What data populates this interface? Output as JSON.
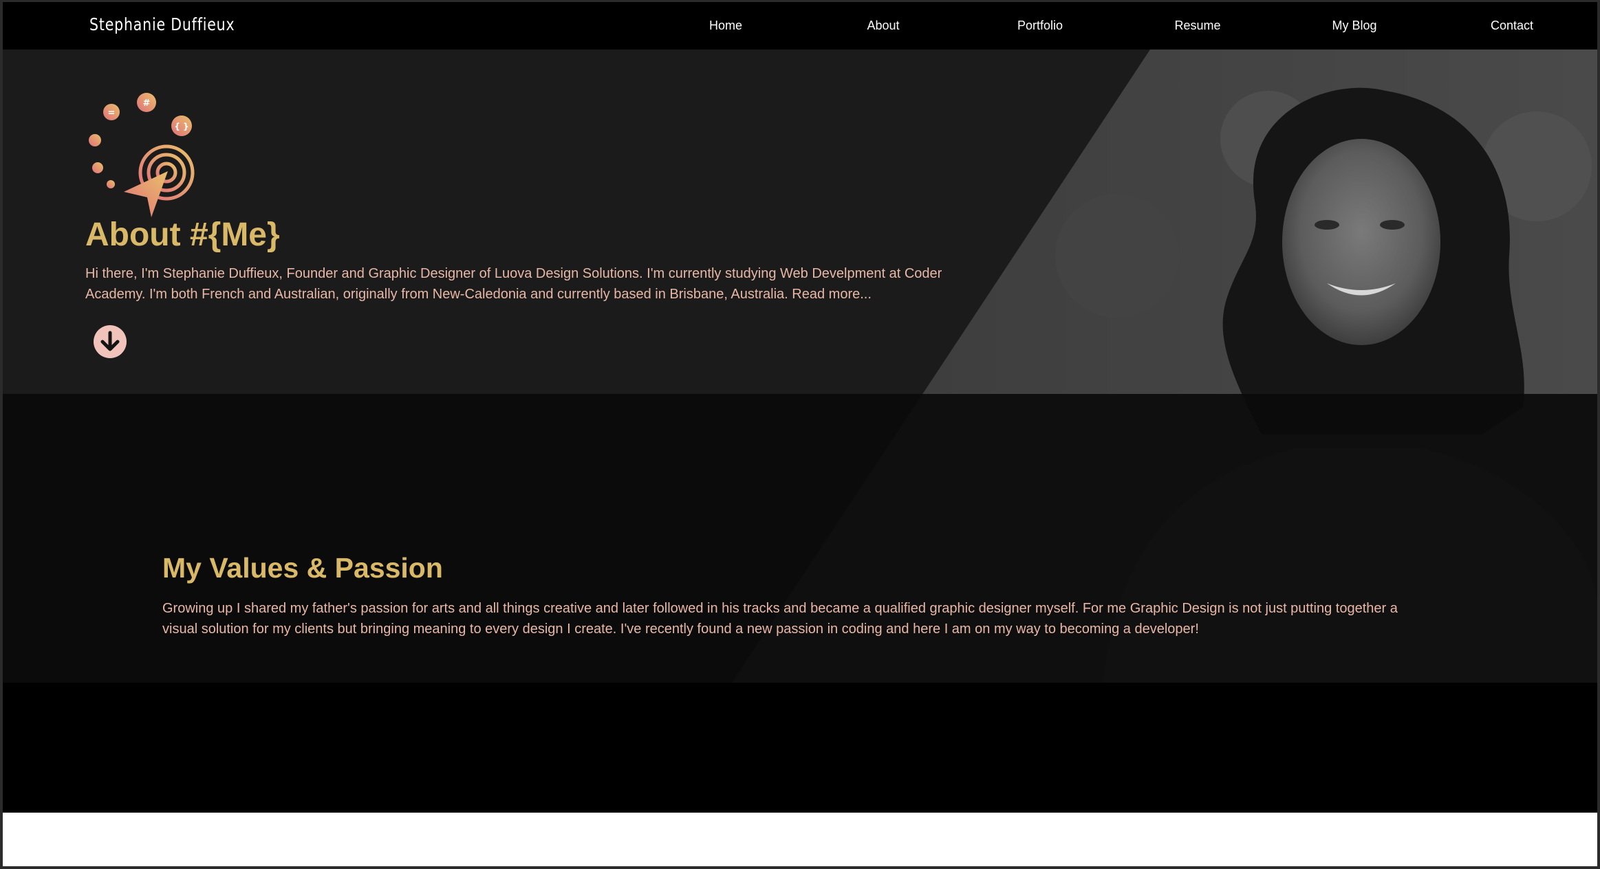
{
  "site": {
    "brand": "Stephanie Duffieux"
  },
  "nav": {
    "items": [
      {
        "label": "Home"
      },
      {
        "label": "About"
      },
      {
        "label": "Portfolio"
      },
      {
        "label": "Resume"
      },
      {
        "label": "My Blog"
      },
      {
        "label": "Contact"
      }
    ]
  },
  "about": {
    "title": "About #{Me}",
    "intro": "Hi there, I'm Stephanie Duffieux, Founder and Graphic Designer of Luova Design Solutions. I'm currently studying Web Develpment at Coder Academy. I'm both French and Australian, originally from New-Caledonia and currently based in Brisbane, Australia. Read more...",
    "logo_glyphs": {
      "equals": "=",
      "hash": "#",
      "braces": "{ }"
    }
  },
  "values": {
    "title": "My Values & Passion",
    "text": "Growing up I shared my father's passion for arts and all things creative and later followed in his tracks and became a qualified graphic designer myself. For me Graphic Design is not just putting together a visual solution for my clients but bringing meaning to every design I create. I've recently found a new passion in coding and here I am on my way to becoming a developer!"
  },
  "colors": {
    "accent_gold": "#d9b968",
    "text_pink": "#e8b7a6",
    "gradient_start": "#e0707a",
    "gradient_end": "#e9c06a"
  },
  "icons": {
    "scroll_down": "arrow-down-circle-icon"
  }
}
